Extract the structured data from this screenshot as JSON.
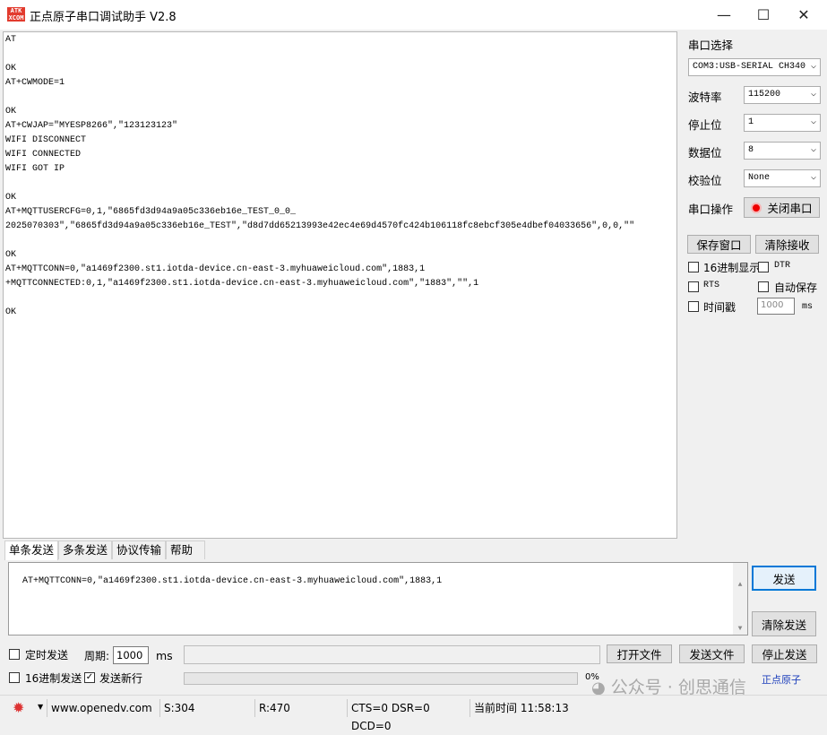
{
  "window": {
    "title": "正点原子串口调试助手 V2.8",
    "logo_text": "ATK XCOM",
    "minimize": "—",
    "maximize": "☐",
    "close": "✕"
  },
  "receive": {
    "text": "AT\n\nOK\nAT+CWMODE=1\n\nOK\nAT+CWJAP=\"MYESP8266\",\"123123123\"\nWIFI DISCONNECT\nWIFI CONNECTED\nWIFI GOT IP\n\nOK\nAT+MQTTUSERCFG=0,1,\"6865fd3d94a9a05c336eb16e_TEST_0_0_\n2025070303\",\"6865fd3d94a9a05c336eb16e_TEST\",\"d8d7dd65213993e42ec4e69d4570fc424b106118fc8ebcf305e4dbef04033656\",0,0,\"\"\n\nOK\nAT+MQTTCONN=0,\"a1469f2300.st1.iotda-device.cn-east-3.myhuaweicloud.com\",1883,1\n+MQTTCONNECTED:0,1,\"a1469f2300.st1.iotda-device.cn-east-3.myhuaweicloud.com\",\"1883\",\"\",1\n\nOK"
  },
  "settings": {
    "port_label": "串口选择",
    "port_value": "COM3:USB-SERIAL CH340",
    "baud_label": "波特率",
    "baud_value": "115200",
    "stopbits_label": "停止位",
    "stopbits_value": "1",
    "databits_label": "数据位",
    "databits_value": "8",
    "parity_label": "校验位",
    "parity_value": "None",
    "op_label": "串口操作",
    "close_port_label": "关闭串口",
    "save_window_label": "保存窗口",
    "clear_receive_label": "清除接收",
    "hex_display_label": "16进制显示",
    "dtr_label": "DTR",
    "rts_label": "RTS",
    "autosave_label": "自动保存",
    "timestamp_label": "时间戳",
    "timestamp_value": "1000",
    "ms_label": "ms"
  },
  "tabs": [
    "单条发送",
    "多条发送",
    "协议传输",
    "帮助"
  ],
  "send": {
    "text": "AT+MQTTCONN=0,\"a1469f2300.st1.iotda-device.cn-east-3.myhuaweicloud.com\",1883,1",
    "send_label": "发送",
    "clear_send_label": "清除发送",
    "timed_send_label": "定时发送",
    "period_label": "周期:",
    "period_value": "1000",
    "ms_label": "ms",
    "open_file_label": "打开文件",
    "send_file_label": "发送文件",
    "stop_send_label": "停止发送",
    "hex_send_label": "16进制发送",
    "newline_label": "发送新行",
    "progress_percent": "0%",
    "brand_link": "正点原子"
  },
  "status": {
    "url": "www.openedv.com",
    "sent": "S:304",
    "received": "R:470",
    "lines": "CTS=0 DSR=0 DCD=0",
    "time_label": "当前时间 11:58:13"
  },
  "watermark": "公众号 · 创思通信"
}
